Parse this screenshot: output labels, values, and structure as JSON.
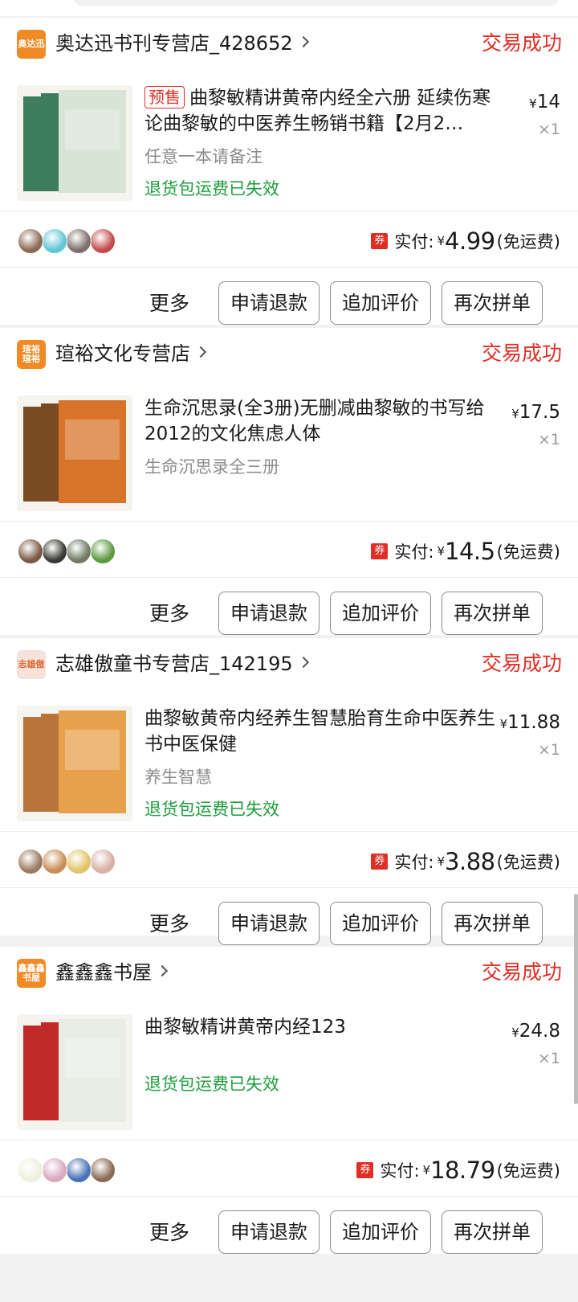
{
  "orders": [
    {
      "store_logo": "奥达迅",
      "store_logo_color": "#f08a24",
      "store_name": "奥达迅书刊专营店_428652",
      "status": "交易成功",
      "presale_tag": "预售",
      "title": "曲黎敏精讲黄帝内经全六册 延续伤寒论曲黎敏的中医养生畅销书籍【2月2…",
      "spec": "任意一本请备注",
      "refund_note": "退货包运费已失效",
      "price_symbol": "¥",
      "price": "14",
      "qty": "×1",
      "coupon": "券",
      "paid_label": "实付:",
      "paid_symbol": "¥",
      "paid_amount": "4.99",
      "freight": "(免运费)",
      "avatar_colors": [
        "#8a6a55",
        "#5fc6d6",
        "#7d6f6a",
        "#c44b4b"
      ],
      "thumb_colors": [
        "#d8e4d6",
        "#3d7d5d"
      ],
      "buttons": {
        "more": "更多",
        "refund": "申请退款",
        "review": "追加评价",
        "again": "再次拼单"
      }
    },
    {
      "store_logo": "瑄裕 瑄裕",
      "store_logo_color": "#f08a24",
      "store_name": "瑄裕文化专营店",
      "status": "交易成功",
      "presale_tag": "",
      "title": "生命沉思录(全3册)无删减曲黎敏的书写给2012的文化焦虑人体",
      "spec": "生命沉思录全三册",
      "refund_note": "",
      "price_symbol": "¥",
      "price": "17.5",
      "qty": "×1",
      "coupon": "券",
      "paid_label": "实付:",
      "paid_symbol": "¥",
      "paid_amount": "14.5",
      "freight": "(免运费)",
      "avatar_colors": [
        "#7a5a45",
        "#3a3a34",
        "#6f7b64",
        "#5d9a3f"
      ],
      "thumb_colors": [
        "#d8742a",
        "#7a4a22"
      ],
      "buttons": {
        "more": "更多",
        "refund": "申请退款",
        "review": "追加评价",
        "again": "再次拼单"
      }
    },
    {
      "store_logo": "志雄傲",
      "store_logo_color": "#f3e3da",
      "store_name": "志雄傲童书专营店_142195",
      "status": "交易成功",
      "presale_tag": "",
      "title": "曲黎敏黄帝内经养生智慧胎育生命中医养生书中医保健",
      "spec": "养生智慧",
      "refund_note": "退货包运费已失效",
      "price_symbol": "¥",
      "price": "11.88",
      "qty": "×1",
      "coupon": "券",
      "paid_label": "实付:",
      "paid_symbol": "¥",
      "paid_amount": "3.88",
      "freight": "(免运费)",
      "avatar_colors": [
        "#9a7a62",
        "#c98d58",
        "#e3c46a",
        "#d8b0a4"
      ],
      "thumb_colors": [
        "#e7a14b",
        "#b9743a"
      ],
      "buttons": {
        "more": "更多",
        "refund": "申请退款",
        "review": "追加评价",
        "again": "再次拼单"
      }
    },
    {
      "store_logo": "鑫鑫鑫 书屋",
      "store_logo_color": "#f08a24",
      "store_name": "鑫鑫鑫书屋",
      "status": "交易成功",
      "presale_tag": "",
      "title": "曲黎敏精讲黄帝内经123",
      "spec": "",
      "refund_note": "退货包运费已失效",
      "price_symbol": "¥",
      "price": "24.8",
      "qty": "×1",
      "coupon": "券",
      "paid_label": "实付:",
      "paid_symbol": "¥",
      "paid_amount": "18.79",
      "freight": "(免运费)",
      "avatar_colors": [
        "#eef0dc",
        "#d9a9c0",
        "#4a73b8",
        "#8a6a55"
      ],
      "thumb_colors": [
        "#e9ede6",
        "#c22a2a"
      ],
      "buttons": {
        "more": "更多",
        "refund": "申请退款",
        "review": "追加评价",
        "again": "再次拼单"
      }
    }
  ]
}
